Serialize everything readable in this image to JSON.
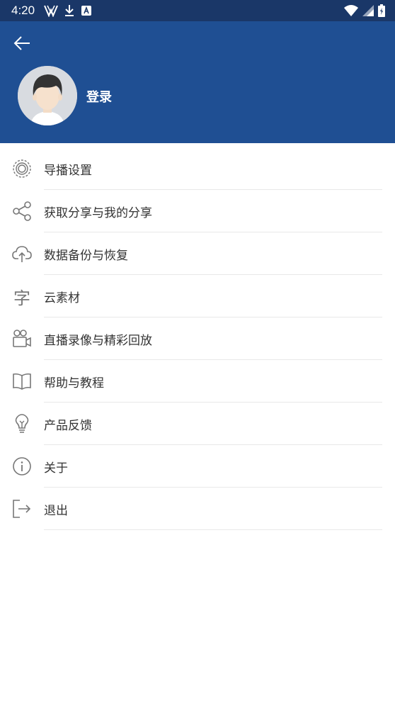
{
  "status_bar": {
    "time": "4:20",
    "left_icons": [
      "vpn-v-icon",
      "download-icon",
      "font-a-icon"
    ],
    "right_icons": [
      "wifi-icon",
      "signal-icon",
      "battery-icon"
    ]
  },
  "header": {
    "background": "#1f4f93",
    "login_label": "登录"
  },
  "menu": {
    "items": [
      {
        "label": "导播设置",
        "icon": "broadcast-settings-icon"
      },
      {
        "label": "获取分享与我的分享",
        "icon": "share-icon"
      },
      {
        "label": "数据备份与恢复",
        "icon": "cloud-upload-icon"
      },
      {
        "label": "云素材",
        "icon": "character-icon",
        "glyph": "字"
      },
      {
        "label": "直播录像与精彩回放",
        "icon": "video-camera-icon"
      },
      {
        "label": "帮助与教程",
        "icon": "book-icon"
      },
      {
        "label": "产品反馈",
        "icon": "lightbulb-icon"
      },
      {
        "label": "关于",
        "icon": "info-icon"
      },
      {
        "label": "退出",
        "icon": "logout-icon"
      }
    ]
  }
}
